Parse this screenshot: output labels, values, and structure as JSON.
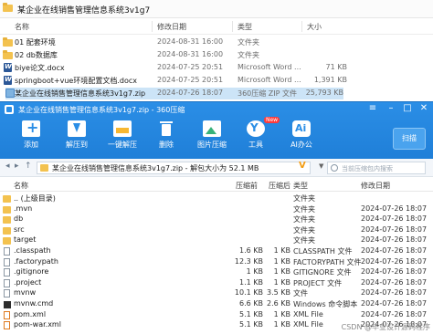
{
  "explorer": {
    "title": "某企业在线销售管理信息系统3v1g7",
    "columns": {
      "name": "名称",
      "date": "修改日期",
      "type": "类型",
      "size": "大小"
    },
    "rows": [
      {
        "name": "01 配套环境",
        "date": "2024-08-31 16:00",
        "type": "文件夹",
        "size": "",
        "icon": "folder-icon"
      },
      {
        "name": "02 db数据库",
        "date": "2024-08-31 16:00",
        "type": "文件夹",
        "size": "",
        "icon": "folder-icon"
      },
      {
        "name": "biye论文.docx",
        "date": "2024-07-25 20:51",
        "type": "Microsoft Word ...",
        "size": "71 KB",
        "icon": "word-doc-icon"
      },
      {
        "name": "springboot+vue环境配置文档.docx",
        "date": "2024-07-25 20:51",
        "type": "Microsoft Word ...",
        "size": "1,391 KB",
        "icon": "word-doc-icon"
      },
      {
        "name": "某企业在线销售管理信息系统3v1g7.zip",
        "date": "2024-07-26 18:07",
        "type": "360压缩 ZIP 文件",
        "size": "25,793 KB",
        "icon": "zip-icon",
        "selected": true
      }
    ]
  },
  "zip": {
    "title": "某企业在线销售管理信息系统3v1g7.zip - 360压缩",
    "toolbar": {
      "add": "添加",
      "extract": "解压到",
      "onekey": "一键解压",
      "delete": "删除",
      "image": "图片压缩",
      "tools": "工具",
      "ai": "AI办公",
      "new_badge": "New",
      "scan": "扫描"
    },
    "address": "某企业在线销售管理信息系统3v1g7.zip - 解包大小为 52.1 MB",
    "search_placeholder": "当前压缩包内搜索",
    "columns": {
      "name": "名称",
      "size": "压缩前",
      "compressed": "压缩后",
      "type": "类型",
      "date": "修改日期"
    },
    "rows": [
      {
        "name": ".. (上级目录)",
        "size": "",
        "compressed": "",
        "type": "文件夹",
        "date": "",
        "icon": "up-folder-icon"
      },
      {
        "name": ".mvn",
        "size": "",
        "compressed": "",
        "type": "文件夹",
        "date": "2024-07-26 18:07",
        "icon": "folder-icon"
      },
      {
        "name": "db",
        "size": "",
        "compressed": "",
        "type": "文件夹",
        "date": "2024-07-26 18:07",
        "icon": "folder-icon"
      },
      {
        "name": "src",
        "size": "",
        "compressed": "",
        "type": "文件夹",
        "date": "2024-07-26 18:07",
        "icon": "folder-icon"
      },
      {
        "name": "target",
        "size": "",
        "compressed": "",
        "type": "文件夹",
        "date": "2024-07-26 18:07",
        "icon": "folder-icon"
      },
      {
        "name": ".classpath",
        "size": "1.6 KB",
        "compressed": "1 KB",
        "type": "CLASSPATH 文件",
        "date": "2024-07-26 18:07",
        "icon": "file-icon"
      },
      {
        "name": ".factorypath",
        "size": "12.3 KB",
        "compressed": "1 KB",
        "type": "FACTORYPATH 文件",
        "date": "2024-07-26 18:07",
        "icon": "file-icon"
      },
      {
        "name": ".gitignore",
        "size": "1 KB",
        "compressed": "1 KB",
        "type": "GITIGNORE 文件",
        "date": "2024-07-26 18:07",
        "icon": "file-icon"
      },
      {
        "name": ".project",
        "size": "1.1 KB",
        "compressed": "1 KB",
        "type": "PROJECT 文件",
        "date": "2024-07-26 18:07",
        "icon": "file-icon"
      },
      {
        "name": "mvnw",
        "size": "10.1 KB",
        "compressed": "3.5 KB",
        "type": "文件",
        "date": "2024-07-26 18:07",
        "icon": "file-icon"
      },
      {
        "name": "mvnw.cmd",
        "size": "6.6 KB",
        "compressed": "2.6 KB",
        "type": "Windows 命令脚本",
        "date": "2024-07-26 18:07",
        "icon": "cmd-icon"
      },
      {
        "name": "pom.xml",
        "size": "5.1 KB",
        "compressed": "1 KB",
        "type": "XML File",
        "date": "2024-07-26 18:07",
        "icon": "xml-icon"
      },
      {
        "name": "pom-war.xml",
        "size": "5.1 KB",
        "compressed": "1 KB",
        "type": "XML File",
        "date": "2024-07-26 18:07",
        "icon": "xml-icon"
      }
    ],
    "watermark": "CSDN @毕业设计源码程序"
  }
}
